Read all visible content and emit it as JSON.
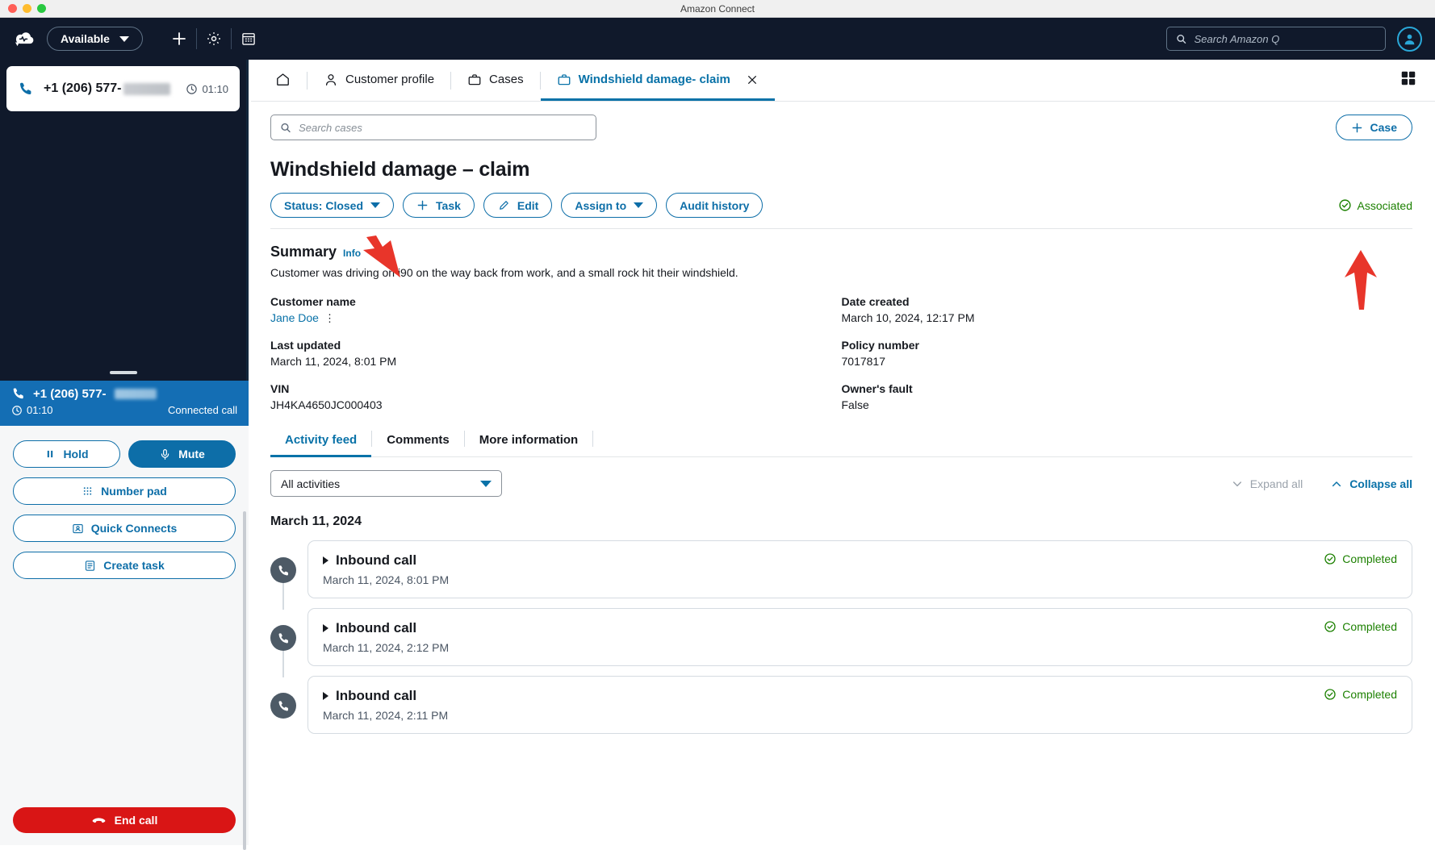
{
  "window": {
    "title": "Amazon Connect"
  },
  "topnav": {
    "logo_icon": "amazon-connect-cloud-logo",
    "status_label": "Available",
    "add_icon": "plus-icon",
    "settings_icon": "gear-icon",
    "calendar_icon": "calendar-icon",
    "search": {
      "placeholder": "Search Amazon Q",
      "value": "",
      "icon": "search-icon"
    },
    "avatar_icon": "user-avatar-icon"
  },
  "ccp": {
    "contact": {
      "phone_icon": "phone-icon",
      "number": "+1 (206) 577-",
      "clock_icon": "clock-icon",
      "timer": "01:10"
    },
    "call_header": {
      "phone_icon": "phone-icon",
      "number": "+1 (206) 577-",
      "clock_icon": "clock-icon",
      "timer": "01:10",
      "state": "Connected call"
    },
    "controls": [
      {
        "label": "Hold",
        "icon": "pause-icon",
        "filled": false
      },
      {
        "label": "Mute",
        "icon": "microphone-icon",
        "filled": true
      },
      {
        "label": "Number pad",
        "icon": "dialpad-icon",
        "filled": false
      },
      {
        "label": "Quick Connects",
        "icon": "contact-card-icon",
        "filled": false
      },
      {
        "label": "Create task",
        "icon": "task-list-icon",
        "filled": false
      }
    ],
    "end_call": {
      "label": "End call",
      "icon": "end-call-icon"
    }
  },
  "tabs": [
    {
      "label": "",
      "icon": "home-icon",
      "active": false,
      "closable": false
    },
    {
      "label": "Customer profile",
      "icon": "person-icon",
      "active": false,
      "closable": false
    },
    {
      "label": "Cases",
      "icon": "briefcase-icon",
      "active": false,
      "closable": false
    },
    {
      "label": "Windshield damage- claim",
      "icon": "briefcase-icon",
      "active": true,
      "closable": true
    }
  ],
  "tabbar": {
    "layout_icon": "grid-layout-icon"
  },
  "toolbar": {
    "search": {
      "placeholder": "Search cases",
      "value": "",
      "icon": "search-icon"
    },
    "case_button": {
      "label": "Case",
      "icon": "plus-icon"
    }
  },
  "case": {
    "title": "Windshield damage – claim",
    "actions": [
      {
        "label": "Status: Closed",
        "icon": "chevron-down-icon",
        "type": "dropdown"
      },
      {
        "label": "Task",
        "icon": "plus-icon",
        "type": "button"
      },
      {
        "label": "Edit",
        "icon": "pencil-icon",
        "type": "button"
      },
      {
        "label": "Assign to",
        "icon": "chevron-down-icon",
        "type": "dropdown"
      },
      {
        "label": "Audit history",
        "icon": "",
        "type": "button"
      }
    ],
    "association": {
      "label": "Associated",
      "icon": "check-circle-icon",
      "color": "#1d8102"
    }
  },
  "summary": {
    "heading": "Summary",
    "info_link": "Info",
    "description": "Customer was driving on i90 on the way back from work, and a small rock hit their windshield.",
    "fields": [
      [
        {
          "label": "Customer name",
          "value": "Jane Doe",
          "is_link": true,
          "has_menu": true
        },
        {
          "label": "Date created",
          "value": "March 10, 2024, 12:17 PM",
          "is_link": false,
          "has_menu": false
        }
      ],
      [
        {
          "label": "Last updated",
          "value": "March 11, 2024, 8:01 PM",
          "is_link": false,
          "has_menu": false
        },
        {
          "label": "Policy number",
          "value": "7017817",
          "is_link": false,
          "has_menu": false
        }
      ],
      [
        {
          "label": "VIN",
          "value": "JH4KA4650JC000403",
          "is_link": false,
          "has_menu": false
        },
        {
          "label": "Owner's fault",
          "value": "False",
          "is_link": false,
          "has_menu": false
        }
      ]
    ]
  },
  "detail_tabs": [
    {
      "label": "Activity feed",
      "active": true
    },
    {
      "label": "Comments",
      "active": false
    },
    {
      "label": "More information",
      "active": false
    }
  ],
  "activity": {
    "filter": {
      "value": "All activities",
      "icon": "chevron-down-icon"
    },
    "expand_all": {
      "label": "Expand all",
      "icon": "chevron-down-icon",
      "enabled": false
    },
    "collapse_all": {
      "label": "Collapse all",
      "icon": "chevron-up-icon",
      "enabled": true
    },
    "day_group": "March 11, 2024",
    "items": [
      {
        "icon": "phone-icon",
        "title": "Inbound call",
        "timestamp": "March 11, 2024, 8:01 PM",
        "status": "Completed",
        "status_icon": "check-circle-icon"
      },
      {
        "icon": "phone-icon",
        "title": "Inbound call",
        "timestamp": "March 11, 2024, 2:12 PM",
        "status": "Completed",
        "status_icon": "check-circle-icon"
      },
      {
        "icon": "phone-icon",
        "title": "Inbound call",
        "timestamp": "March 11, 2024, 2:11 PM",
        "status": "Completed",
        "status_icon": "check-circle-icon"
      }
    ]
  },
  "annotations": [
    {
      "name": "arrow-status-closed",
      "color": "#e8352a"
    },
    {
      "name": "arrow-associated",
      "color": "#e8352a"
    }
  ]
}
